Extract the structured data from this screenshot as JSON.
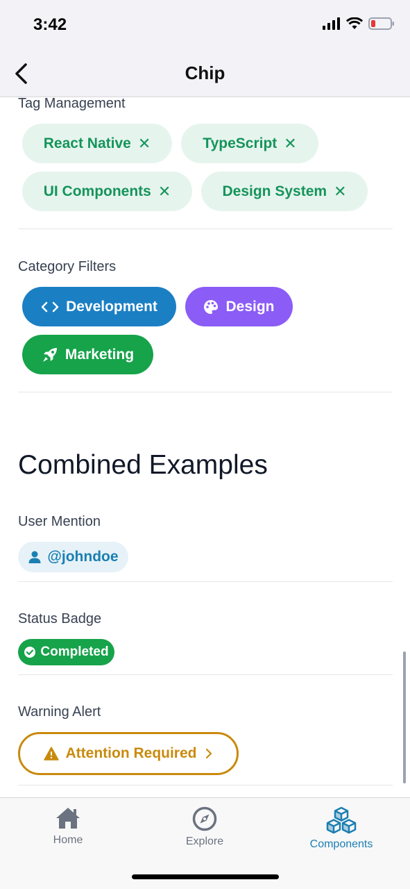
{
  "status_bar": {
    "time": "3:42"
  },
  "nav": {
    "title": "Chip"
  },
  "tag_management": {
    "label": "Tag Management",
    "tags": [
      {
        "label": "React Native",
        "remove": "✕"
      },
      {
        "label": "TypeScript",
        "remove": "✕"
      },
      {
        "label": "UI Components",
        "remove": "✕"
      },
      {
        "label": "Design System",
        "remove": "✕"
      }
    ]
  },
  "category_filters": {
    "label": "Category Filters",
    "chips": [
      {
        "label": "Development",
        "icon": "code-icon",
        "color": "#1b7fc4"
      },
      {
        "label": "Design",
        "icon": "palette-icon",
        "color": "#8b5cf6"
      },
      {
        "label": "Marketing",
        "icon": "rocket-icon",
        "color": "#16a34a"
      }
    ]
  },
  "combined": {
    "heading": "Combined Examples",
    "user_mention": {
      "label": "User Mention",
      "chip": "@johndoe",
      "icon": "user-icon"
    },
    "status_badge": {
      "label": "Status Badge",
      "chip": "Completed",
      "icon": "check-circle-icon",
      "color": "#16a34a"
    },
    "warning_alert": {
      "label": "Warning Alert",
      "chip": "Attention Required",
      "icon": "warning-icon",
      "trailing_icon": "chevron-right-icon",
      "color": "#c98a0c"
    }
  },
  "tab_bar": {
    "tabs": [
      {
        "label": "Home",
        "icon": "home-icon",
        "active": false
      },
      {
        "label": "Explore",
        "icon": "compass-icon",
        "active": false
      },
      {
        "label": "Components",
        "icon": "cubes-icon",
        "active": true
      }
    ]
  },
  "colors": {
    "accent": "#1b7fb2",
    "tag_bg": "#e6f4ee",
    "tag_fg": "#15945a"
  }
}
